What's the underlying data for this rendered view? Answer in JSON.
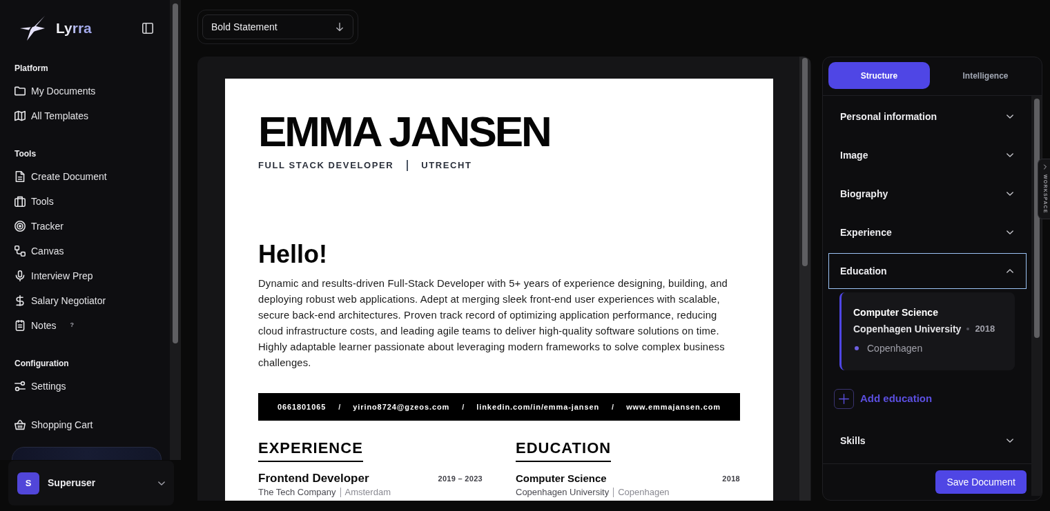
{
  "sidebar": {
    "brand": "Lyrra",
    "sections": [
      {
        "title": "Platform",
        "items": [
          {
            "label": "My Documents"
          },
          {
            "label": "All Templates"
          }
        ]
      },
      {
        "title": "Tools",
        "items": [
          {
            "label": "Create Document"
          },
          {
            "label": "Tools"
          },
          {
            "label": "Tracker"
          },
          {
            "label": "Canvas"
          },
          {
            "label": "Interview Prep"
          },
          {
            "label": "Salary Negotiator"
          },
          {
            "label": "Notes",
            "badge": "?"
          }
        ]
      },
      {
        "title": "Configuration",
        "items": [
          {
            "label": "Settings"
          }
        ]
      },
      {
        "items": [
          {
            "label": "Shopping Cart"
          }
        ]
      }
    ],
    "user": {
      "initial": "S",
      "name": "Superuser"
    }
  },
  "toolbar": {
    "template_select": {
      "value": "Bold Statement"
    }
  },
  "resume": {
    "name": "EMMA JANSEN",
    "headline": [
      "FULL STACK DEVELOPER",
      "UTRECHT"
    ],
    "greeting": "Hello!",
    "summary": "Dynamic and results-driven Full-Stack Developer with 5+ years of experience designing, building, and deploying robust web applications. Adept at merging sleek front-end user experiences with scalable, secure back-end architectures. Proven track record of optimizing application performance, reducing cloud infrastructure costs, and leading agile teams to deliver high-quality software solutions on time. Highly adaptable learner passionate about leveraging modern frameworks to solve complex business challenges.",
    "contacts": [
      {
        "kind": "item",
        "text": "0661801065"
      },
      {
        "kind": "separator",
        "text": "/"
      },
      {
        "kind": "item",
        "text": "yirino8724@gzeos.com"
      },
      {
        "kind": "separator",
        "text": "/"
      },
      {
        "kind": "item",
        "text": "linkedin.com/in/emma-jansen"
      },
      {
        "kind": "separator",
        "text": "/"
      },
      {
        "kind": "item",
        "text": "www.emmajansen.com"
      }
    ],
    "experience": {
      "title": "EXPERIENCE",
      "entries": [
        {
          "role": "Frontend Developer",
          "period": "2019 – 2023",
          "company": "The Tech Company",
          "location": "Amsterdam"
        }
      ]
    },
    "education": {
      "title": "EDUCATION",
      "entries": [
        {
          "degree": "Computer Science",
          "year": "2018",
          "school": "Copenhagen University",
          "city": "Copenhagen"
        }
      ]
    }
  },
  "panel": {
    "tabs": [
      {
        "label": "Structure",
        "selected": true
      },
      {
        "label": "Intelligence",
        "selected": false
      }
    ],
    "sections": [
      {
        "title": "Personal information",
        "expanded": false
      },
      {
        "title": "Image",
        "expanded": false
      },
      {
        "title": "Biography",
        "expanded": false
      },
      {
        "title": "Experience",
        "expanded": false
      },
      {
        "title": "Education",
        "expanded": true,
        "entries": [
          {
            "degree": "Computer Science",
            "school": "Copenhagen University",
            "year": "2018",
            "city": "Copenhagen"
          }
        ],
        "add_label": "Add education"
      },
      {
        "title": "Skills",
        "expanded": false
      }
    ],
    "save_label": "Save Document"
  },
  "side_tab": {
    "label": "WORKSPACE"
  }
}
